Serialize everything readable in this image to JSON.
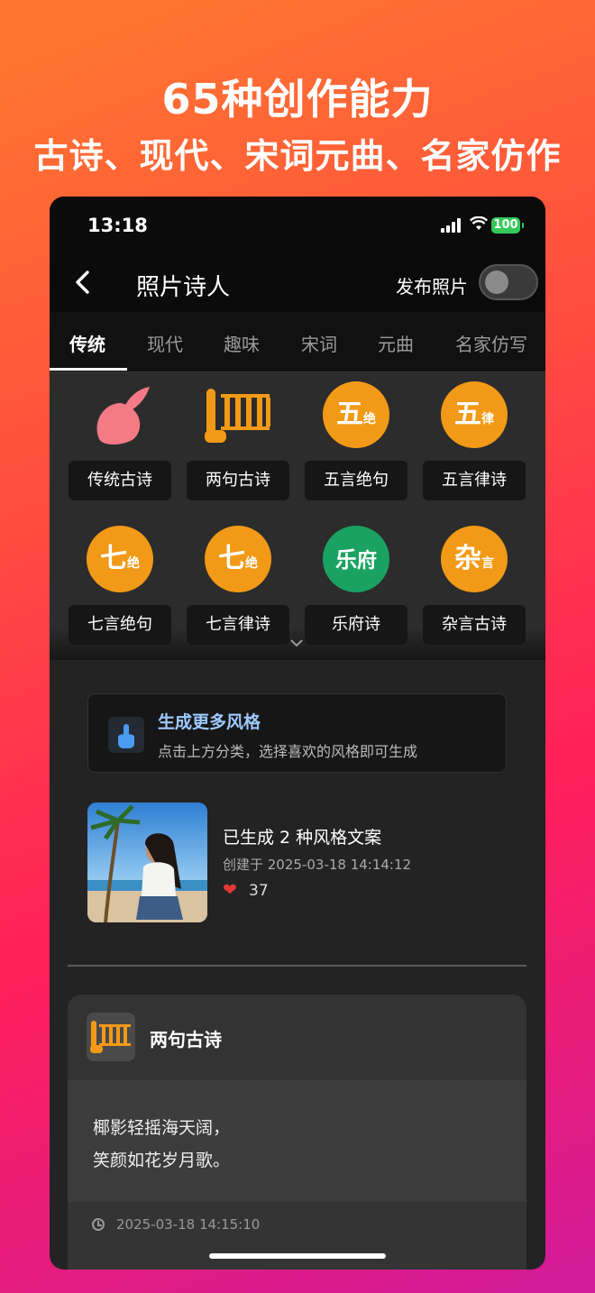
{
  "promo": {
    "title": "65种创作能力",
    "subtitle": "古诗、现代、宋词元曲、名家仿作"
  },
  "status_bar": {
    "time": "13:18",
    "battery": "100"
  },
  "navbar": {
    "back_icon": "chevron-left-icon",
    "title": "照片诗人",
    "publish_label": "发布照片",
    "publish_toggle_on": false
  },
  "tabs": [
    {
      "label": "传统",
      "active": true
    },
    {
      "label": "现代"
    },
    {
      "label": "趣味"
    },
    {
      "label": "宋词"
    },
    {
      "label": "元曲"
    },
    {
      "label": "名家仿写"
    }
  ],
  "styles": [
    {
      "label": "传统古诗",
      "icon": "peach-icon"
    },
    {
      "label": "两句古诗",
      "icon": "bamboo-slips-icon"
    },
    {
      "label": "五言绝句",
      "icon": "wu-jue-icon",
      "glyph": "五",
      "small": "绝"
    },
    {
      "label": "五言律诗",
      "icon": "wu-lv-icon",
      "glyph": "五",
      "small": "律"
    },
    {
      "label": "七言绝句",
      "icon": "qi-jue-icon",
      "glyph": "七",
      "small": "绝"
    },
    {
      "label": "七言律诗",
      "icon": "qi-lv-icon",
      "glyph": "七",
      "small": "绝"
    },
    {
      "label": "乐府诗",
      "icon": "yuefu-icon",
      "glyph": "乐",
      "small": "府"
    },
    {
      "label": "杂言古诗",
      "icon": "zayan-icon",
      "glyph": "杂",
      "small": "言"
    }
  ],
  "more_styles": {
    "title": "生成更多风格",
    "subtitle": "点击上方分类，选择喜欢的风格即可生成"
  },
  "generated": {
    "title": "已生成 2 种风格文案",
    "created": "创建于 2025-03-18 14:14:12",
    "likes": "37"
  },
  "poem": {
    "title": "两句古诗",
    "lines": [
      "椰影轻摇海天阔，",
      "笑颜如花岁月歌。"
    ],
    "date": "2025-03-18 14:15:10"
  },
  "colors": {
    "accent": "#f29a17",
    "green": "#1aa262",
    "peach": "#f47a86",
    "link": "#9ec9ff"
  }
}
